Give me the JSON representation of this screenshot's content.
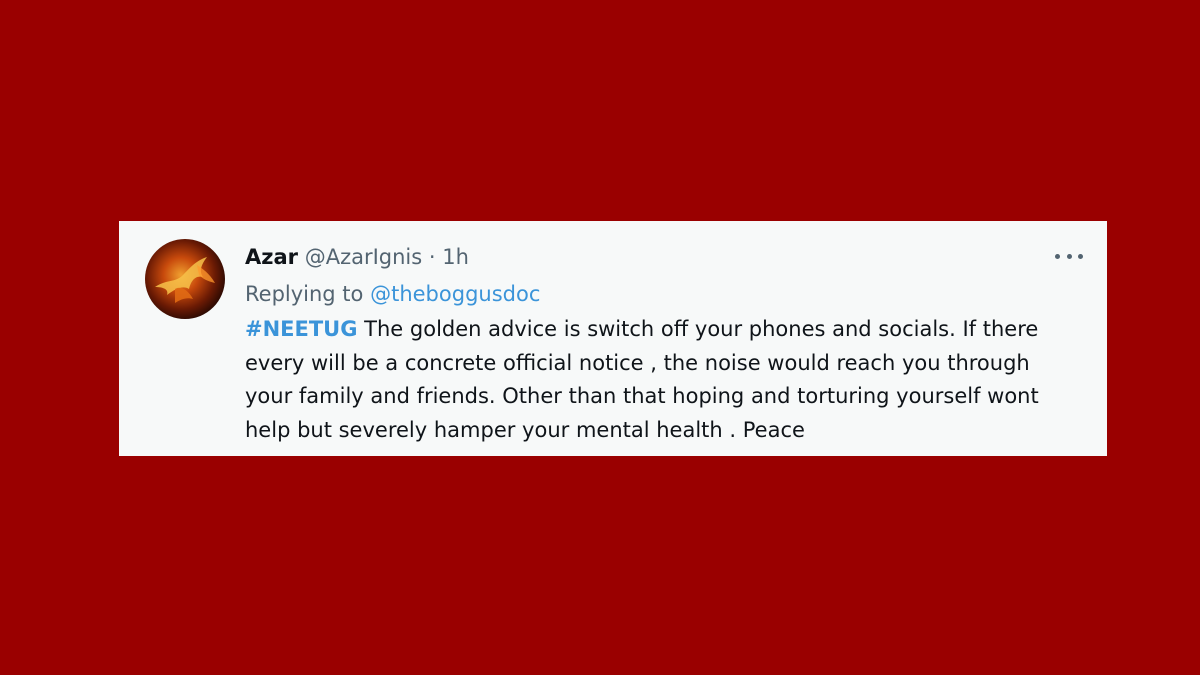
{
  "tweet": {
    "display_name": "Azar",
    "handle": "@AzarIgnis",
    "separator": "·",
    "time": "1h",
    "replying_prefix": "Replying to",
    "replying_to": "@theboggusdoc",
    "hashtag": "#NEETUG",
    "text_line1": " The golden advice is switch off your phones and socials. If there",
    "text_line2": "every will be a concrete official notice , the noise would reach you through",
    "text_line3": "your family and friends. Other than that hoping and torturing yourself wont",
    "text_line4": "help but severely hamper your mental health . Peace",
    "more_icon": "more-horizontal-icon",
    "avatar_icon": "phoenix-avatar"
  },
  "colors": {
    "background": "#9a0000",
    "card": "#f7f9f9",
    "link": "#3b94d9",
    "text": "#0f1419",
    "muted": "#536471"
  }
}
